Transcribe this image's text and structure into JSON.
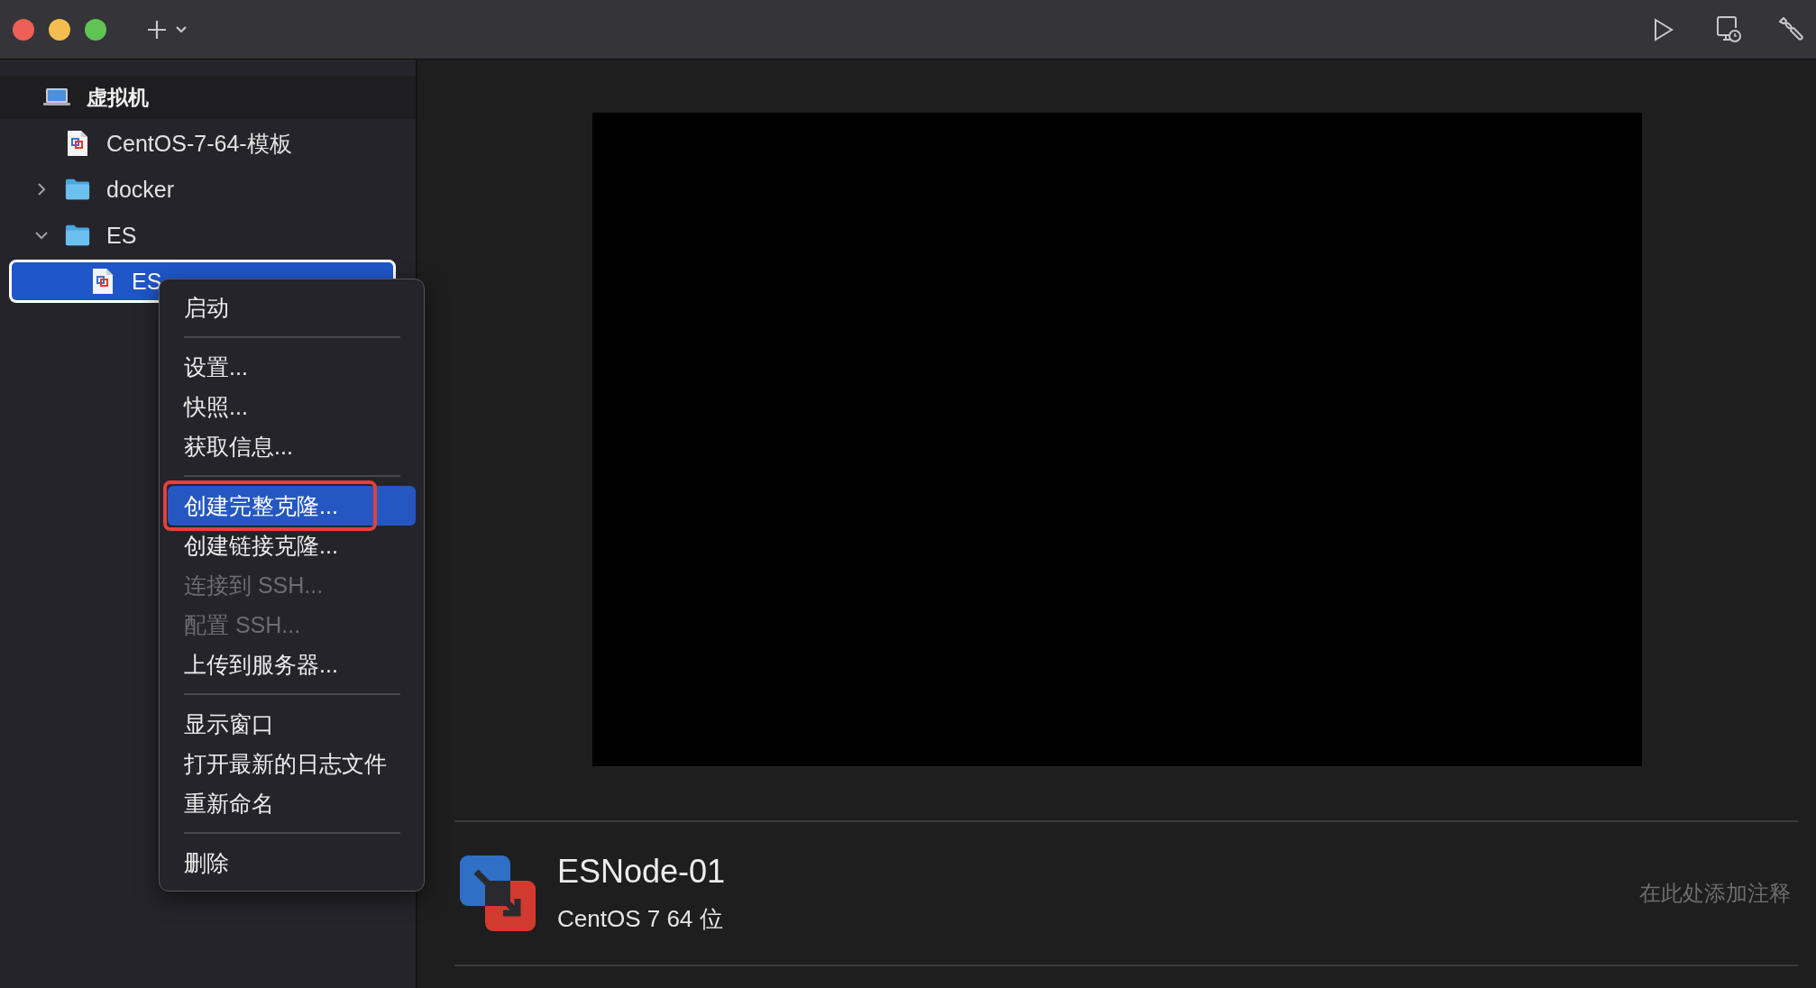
{
  "sidebar": {
    "header": "虚拟机",
    "items": [
      {
        "label": "CentOS-7-64-模板",
        "kind": "vm",
        "selected": false
      },
      {
        "label": "docker",
        "kind": "folder",
        "expanded": false,
        "selected": false
      },
      {
        "label": "ES",
        "kind": "folder",
        "expanded": true,
        "selected": false,
        "children": [
          {
            "label": "ES",
            "kind": "vm",
            "selected": true
          }
        ]
      }
    ]
  },
  "context_menu": {
    "items": [
      {
        "kind": "item",
        "label": "启动",
        "disabled": false,
        "selected": false
      },
      {
        "kind": "separator"
      },
      {
        "kind": "item",
        "label": "设置...",
        "disabled": false,
        "selected": false
      },
      {
        "kind": "item",
        "label": "快照...",
        "disabled": false,
        "selected": false
      },
      {
        "kind": "item",
        "label": "获取信息...",
        "disabled": false,
        "selected": false
      },
      {
        "kind": "separator"
      },
      {
        "kind": "item",
        "label": "创建完整克隆...",
        "disabled": false,
        "selected": true,
        "outlined": true
      },
      {
        "kind": "item",
        "label": "创建链接克隆...",
        "disabled": false,
        "selected": false
      },
      {
        "kind": "item",
        "label": "连接到 SSH...",
        "disabled": true,
        "selected": false
      },
      {
        "kind": "item",
        "label": "配置 SSH...",
        "disabled": true,
        "selected": false
      },
      {
        "kind": "item",
        "label": "上传到服务器...",
        "disabled": false,
        "selected": false
      },
      {
        "kind": "separator"
      },
      {
        "kind": "item",
        "label": "显示窗口",
        "disabled": false,
        "selected": false
      },
      {
        "kind": "item",
        "label": "打开最新的日志文件",
        "disabled": false,
        "selected": false
      },
      {
        "kind": "item",
        "label": "重新命名",
        "disabled": false,
        "selected": false
      },
      {
        "kind": "separator"
      },
      {
        "kind": "item",
        "label": "删除",
        "disabled": false,
        "selected": false
      }
    ]
  },
  "details": {
    "name": "ESNode-01",
    "os": "CentOS 7 64 位",
    "notes": {
      "placeholder": "在此处添加注释"
    }
  }
}
